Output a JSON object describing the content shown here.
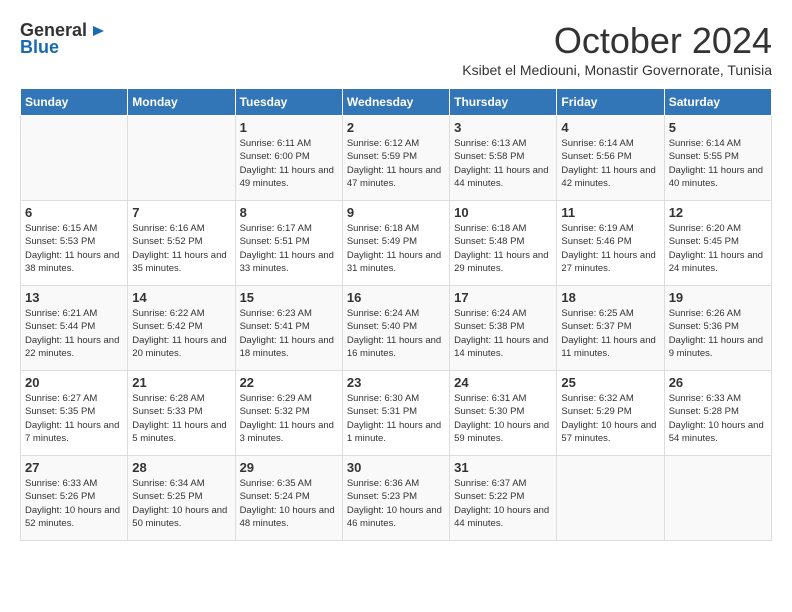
{
  "logo": {
    "general": "General",
    "blue": "Blue"
  },
  "title": "October 2024",
  "location": "Ksibet el Mediouni, Monastir Governorate, Tunisia",
  "headers": [
    "Sunday",
    "Monday",
    "Tuesday",
    "Wednesday",
    "Thursday",
    "Friday",
    "Saturday"
  ],
  "weeks": [
    [
      {
        "day": "",
        "info": ""
      },
      {
        "day": "",
        "info": ""
      },
      {
        "day": "1",
        "info": "Sunrise: 6:11 AM\nSunset: 6:00 PM\nDaylight: 11 hours and 49 minutes."
      },
      {
        "day": "2",
        "info": "Sunrise: 6:12 AM\nSunset: 5:59 PM\nDaylight: 11 hours and 47 minutes."
      },
      {
        "day": "3",
        "info": "Sunrise: 6:13 AM\nSunset: 5:58 PM\nDaylight: 11 hours and 44 minutes."
      },
      {
        "day": "4",
        "info": "Sunrise: 6:14 AM\nSunset: 5:56 PM\nDaylight: 11 hours and 42 minutes."
      },
      {
        "day": "5",
        "info": "Sunrise: 6:14 AM\nSunset: 5:55 PM\nDaylight: 11 hours and 40 minutes."
      }
    ],
    [
      {
        "day": "6",
        "info": "Sunrise: 6:15 AM\nSunset: 5:53 PM\nDaylight: 11 hours and 38 minutes."
      },
      {
        "day": "7",
        "info": "Sunrise: 6:16 AM\nSunset: 5:52 PM\nDaylight: 11 hours and 35 minutes."
      },
      {
        "day": "8",
        "info": "Sunrise: 6:17 AM\nSunset: 5:51 PM\nDaylight: 11 hours and 33 minutes."
      },
      {
        "day": "9",
        "info": "Sunrise: 6:18 AM\nSunset: 5:49 PM\nDaylight: 11 hours and 31 minutes."
      },
      {
        "day": "10",
        "info": "Sunrise: 6:18 AM\nSunset: 5:48 PM\nDaylight: 11 hours and 29 minutes."
      },
      {
        "day": "11",
        "info": "Sunrise: 6:19 AM\nSunset: 5:46 PM\nDaylight: 11 hours and 27 minutes."
      },
      {
        "day": "12",
        "info": "Sunrise: 6:20 AM\nSunset: 5:45 PM\nDaylight: 11 hours and 24 minutes."
      }
    ],
    [
      {
        "day": "13",
        "info": "Sunrise: 6:21 AM\nSunset: 5:44 PM\nDaylight: 11 hours and 22 minutes."
      },
      {
        "day": "14",
        "info": "Sunrise: 6:22 AM\nSunset: 5:42 PM\nDaylight: 11 hours and 20 minutes."
      },
      {
        "day": "15",
        "info": "Sunrise: 6:23 AM\nSunset: 5:41 PM\nDaylight: 11 hours and 18 minutes."
      },
      {
        "day": "16",
        "info": "Sunrise: 6:24 AM\nSunset: 5:40 PM\nDaylight: 11 hours and 16 minutes."
      },
      {
        "day": "17",
        "info": "Sunrise: 6:24 AM\nSunset: 5:38 PM\nDaylight: 11 hours and 14 minutes."
      },
      {
        "day": "18",
        "info": "Sunrise: 6:25 AM\nSunset: 5:37 PM\nDaylight: 11 hours and 11 minutes."
      },
      {
        "day": "19",
        "info": "Sunrise: 6:26 AM\nSunset: 5:36 PM\nDaylight: 11 hours and 9 minutes."
      }
    ],
    [
      {
        "day": "20",
        "info": "Sunrise: 6:27 AM\nSunset: 5:35 PM\nDaylight: 11 hours and 7 minutes."
      },
      {
        "day": "21",
        "info": "Sunrise: 6:28 AM\nSunset: 5:33 PM\nDaylight: 11 hours and 5 minutes."
      },
      {
        "day": "22",
        "info": "Sunrise: 6:29 AM\nSunset: 5:32 PM\nDaylight: 11 hours and 3 minutes."
      },
      {
        "day": "23",
        "info": "Sunrise: 6:30 AM\nSunset: 5:31 PM\nDaylight: 11 hours and 1 minute."
      },
      {
        "day": "24",
        "info": "Sunrise: 6:31 AM\nSunset: 5:30 PM\nDaylight: 10 hours and 59 minutes."
      },
      {
        "day": "25",
        "info": "Sunrise: 6:32 AM\nSunset: 5:29 PM\nDaylight: 10 hours and 57 minutes."
      },
      {
        "day": "26",
        "info": "Sunrise: 6:33 AM\nSunset: 5:28 PM\nDaylight: 10 hours and 54 minutes."
      }
    ],
    [
      {
        "day": "27",
        "info": "Sunrise: 6:33 AM\nSunset: 5:26 PM\nDaylight: 10 hours and 52 minutes."
      },
      {
        "day": "28",
        "info": "Sunrise: 6:34 AM\nSunset: 5:25 PM\nDaylight: 10 hours and 50 minutes."
      },
      {
        "day": "29",
        "info": "Sunrise: 6:35 AM\nSunset: 5:24 PM\nDaylight: 10 hours and 48 minutes."
      },
      {
        "day": "30",
        "info": "Sunrise: 6:36 AM\nSunset: 5:23 PM\nDaylight: 10 hours and 46 minutes."
      },
      {
        "day": "31",
        "info": "Sunrise: 6:37 AM\nSunset: 5:22 PM\nDaylight: 10 hours and 44 minutes."
      },
      {
        "day": "",
        "info": ""
      },
      {
        "day": "",
        "info": ""
      }
    ]
  ]
}
